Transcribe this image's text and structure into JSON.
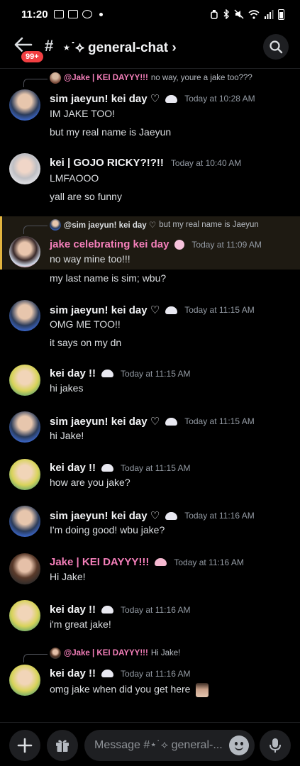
{
  "status_bar": {
    "time": "11:20"
  },
  "header": {
    "badge": "99+",
    "hash": "#",
    "channel": "⋆˙⟡ general-chat ›"
  },
  "messages": [
    {
      "reply": {
        "name": "@Jake | KEI DAYYY!!!",
        "text": "no way, youre a jake too???"
      },
      "name": "sim jaeyun! kei day ♡",
      "time": "Today at 10:28 AM",
      "lines": [
        "IM JAKE TOO!",
        "but my real name is Jaeyun"
      ]
    },
    {
      "name": "kei | GOJO RICKY?!?!!",
      "time": "Today at 10:40 AM",
      "lines": [
        "LMFAOOO",
        "yall are so funny"
      ]
    },
    {
      "reply": {
        "name": "@sim jaeyun! kei day ♡",
        "text": "but my real name is Jaeyun"
      },
      "name": "jake celebrating kei day",
      "time": "Today at 11:09 AM",
      "lines": [
        "no way mine too!!!",
        "my last name is sim; wbu?"
      ]
    },
    {
      "name": "sim jaeyun! kei day ♡",
      "time": "Today at 11:15 AM",
      "lines": [
        "OMG ME TOO!!",
        "it says on my dn"
      ]
    },
    {
      "name": "kei day !!",
      "time": "Today at 11:15 AM",
      "lines": [
        "hi jakes"
      ]
    },
    {
      "name": "sim jaeyun! kei day ♡",
      "time": "Today at 11:15 AM",
      "lines": [
        "hi Jake!"
      ]
    },
    {
      "name": "kei day !!",
      "time": "Today at 11:15 AM",
      "lines": [
        "how are you jake?"
      ]
    },
    {
      "name": "sim jaeyun! kei day ♡",
      "time": "Today at 11:16 AM",
      "lines": [
        "I'm doing good! wbu jake?"
      ]
    },
    {
      "name": "Jake | KEI DAYYY!!!",
      "time": "Today at 11:16 AM",
      "lines": [
        "Hi Jake!"
      ]
    },
    {
      "name": "kei day !!",
      "time": "Today at 11:16 AM",
      "lines": [
        "i'm great jake!"
      ]
    },
    {
      "reply": {
        "name": "@Jake | KEI DAYYY!!!",
        "text": "Hi Jake!"
      },
      "name": "kei day !!",
      "time": "Today at 11:16 AM",
      "lines": [
        "omg jake when did you get here"
      ]
    }
  ],
  "composer": {
    "placeholder": "Message #⋆˙⟡ general-..."
  },
  "colors": {
    "pink_name": "#f47fba",
    "highlight_bar": "#e2b43f",
    "badge": "#f23f42"
  }
}
